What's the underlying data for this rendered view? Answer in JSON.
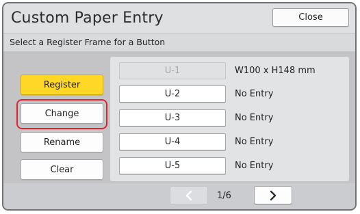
{
  "header": {
    "title": "Custom Paper Entry",
    "close_label": "Close"
  },
  "instruction": "Select a Register Frame for a Button",
  "actions": [
    {
      "label": "Register",
      "state": "active"
    },
    {
      "label": "Change",
      "state": "highlighted"
    },
    {
      "label": "Rename",
      "state": "normal"
    },
    {
      "label": "Clear",
      "state": "normal"
    }
  ],
  "slots": [
    {
      "id": "U-1",
      "description": "W100 x H148 mm",
      "selected": true
    },
    {
      "id": "U-2",
      "description": "No Entry",
      "selected": false
    },
    {
      "id": "U-3",
      "description": "No Entry",
      "selected": false
    },
    {
      "id": "U-4",
      "description": "No Entry",
      "selected": false
    },
    {
      "id": "U-5",
      "description": "No Entry",
      "selected": false
    }
  ],
  "pagination": {
    "indicator": "1/6",
    "prev_icon": "chevron-left-icon",
    "next_icon": "chevron-right-icon",
    "prev_enabled": false,
    "next_enabled": true
  },
  "colors": {
    "active_button": "#ffd726",
    "highlight_ring": "#e0242f",
    "background": "#c4c4c6"
  }
}
